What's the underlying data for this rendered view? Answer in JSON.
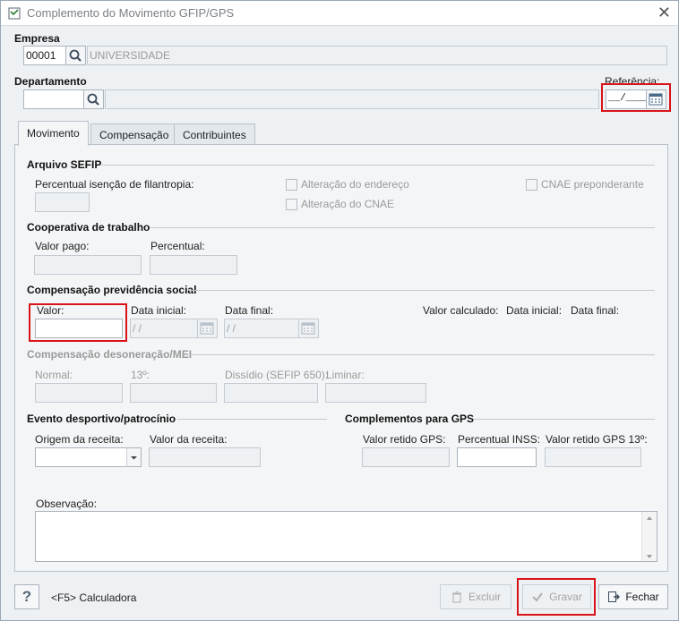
{
  "window": {
    "title": "Complemento do Movimento  GFIP/GPS"
  },
  "header": {
    "empresa_label": "Empresa",
    "empresa_code": "00001",
    "empresa_name": "UNIVERSIDADE",
    "departamento_label": "Departamento",
    "departamento_code": "",
    "departamento_name": "",
    "referencia_label": "Referência:",
    "referencia_value": "__/____"
  },
  "tabs": [
    {
      "label": "Movimento"
    },
    {
      "label": "Compensação"
    },
    {
      "label": "Contribuintes"
    }
  ],
  "sefip": {
    "title": "Arquivo SEFIP",
    "percentual_label": "Percentual isenção de filantropia:",
    "alt_endereco": "Alteração do endereço",
    "alt_cnae": "Alteração do CNAE",
    "cnae_pred": "CNAE preponderante"
  },
  "cooperativa": {
    "title": "Cooperativa de trabalho",
    "valor_pago": "Valor pago:",
    "percentual": "Percentual:"
  },
  "comp_prev": {
    "title": "Compensação previdência social",
    "valor": "Valor:",
    "data_inicial": "Data inicial:",
    "data_final": "Data final:",
    "date_placeholder": "/ /",
    "valor_calculado": "Valor calculado:",
    "data_inicial2": "Data inicial:",
    "data_final2": "Data final:"
  },
  "comp_deson": {
    "title": "Compensação desoneração/MEI",
    "normal": "Normal:",
    "decimo": "13º:",
    "dissidio": "Dissídio (SEFIP 650):",
    "liminar": "Liminar:"
  },
  "evento": {
    "title": "Evento desportivo/patrocínio",
    "origem": "Origem da receita:",
    "valor": "Valor da receita:"
  },
  "gps": {
    "title": "Complementos para GPS",
    "valor_retido": "Valor retido GPS:",
    "percentual_inss": "Percentual INSS:",
    "valor_retido_13": "Valor retido GPS 13º:"
  },
  "observacao": {
    "label": "Observação:"
  },
  "footer": {
    "help": "?",
    "calc": "<F5> Calculadora",
    "excluir": "Excluir",
    "gravar": "Gravar",
    "fechar": "Fechar"
  },
  "colors": {
    "highlight": "#d8141a",
    "window_bg": "#eef1f4"
  }
}
